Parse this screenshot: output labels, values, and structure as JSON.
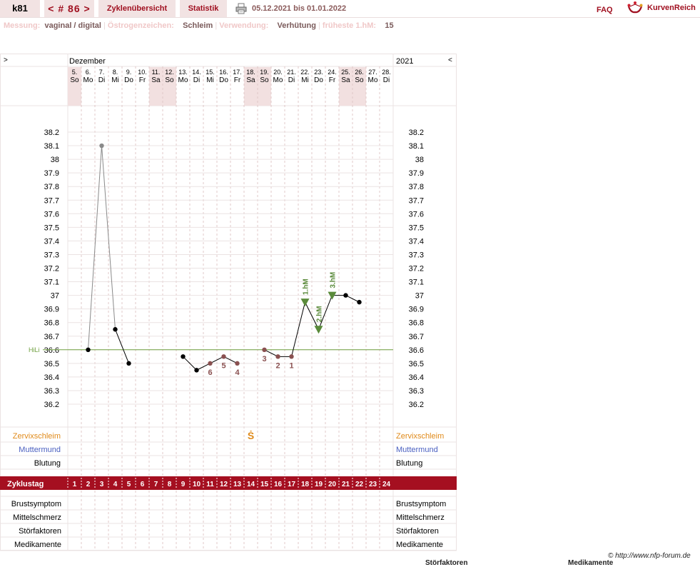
{
  "topbar": {
    "user": "k81",
    "cycle": "< # 86 >",
    "tab_overview": "Zyklenübersicht",
    "tab_stats": "Statistik",
    "date_range": "05.12.2021 bis 01.01.2022",
    "faq": "FAQ",
    "logo_text": "KurvenReich"
  },
  "info": {
    "measure_label": "Messung:",
    "measure_value": "vaginal / digital",
    "estrogen_label": "Östrogenzeichen:",
    "estrogen_value": "Schleim",
    "use_label": "Verwendung:",
    "use_value": "Verhütung",
    "earliest_label": "früheste 1.hM:",
    "earliest_value": "15"
  },
  "nav": {
    "prev": ">",
    "next": "<",
    "month": "Dezember",
    "year": "2021"
  },
  "chart_data": {
    "type": "line",
    "days": [
      {
        "date": "5.",
        "wd": "So",
        "weekend": true
      },
      {
        "date": "6.",
        "wd": "Mo",
        "weekend": false
      },
      {
        "date": "7.",
        "wd": "Di",
        "weekend": false
      },
      {
        "date": "8.",
        "wd": "Mi",
        "weekend": false
      },
      {
        "date": "9.",
        "wd": "Do",
        "weekend": false
      },
      {
        "date": "10.",
        "wd": "Fr",
        "weekend": false
      },
      {
        "date": "11.",
        "wd": "Sa",
        "weekend": true
      },
      {
        "date": "12.",
        "wd": "So",
        "weekend": true
      },
      {
        "date": "13.",
        "wd": "Mo",
        "weekend": false
      },
      {
        "date": "14.",
        "wd": "Di",
        "weekend": false
      },
      {
        "date": "15.",
        "wd": "Mi",
        "weekend": false
      },
      {
        "date": "16.",
        "wd": "Do",
        "weekend": false
      },
      {
        "date": "17.",
        "wd": "Fr",
        "weekend": false
      },
      {
        "date": "18.",
        "wd": "Sa",
        "weekend": true
      },
      {
        "date": "19.",
        "wd": "So",
        "weekend": true
      },
      {
        "date": "20.",
        "wd": "Mo",
        "weekend": false
      },
      {
        "date": "21.",
        "wd": "Di",
        "weekend": false
      },
      {
        "date": "22.",
        "wd": "Mi",
        "weekend": false
      },
      {
        "date": "23.",
        "wd": "Do",
        "weekend": false
      },
      {
        "date": "24.",
        "wd": "Fr",
        "weekend": false
      },
      {
        "date": "25.",
        "wd": "Sa",
        "weekend": true
      },
      {
        "date": "26.",
        "wd": "So",
        "weekend": true
      },
      {
        "date": "27.",
        "wd": "Mo",
        "weekend": false
      },
      {
        "date": "28.",
        "wd": "Di",
        "weekend": false
      }
    ],
    "cycle_days": [
      "1",
      "2",
      "3",
      "4",
      "5",
      "6",
      "7",
      "8",
      "9",
      "10",
      "11",
      "12",
      "13",
      "14",
      "15",
      "16",
      "17",
      "18",
      "19",
      "20",
      "21",
      "22",
      "23",
      "24"
    ],
    "y_ticks": [
      "38.2",
      "38.1",
      "38",
      "37.9",
      "37.8",
      "37.7",
      "37.6",
      "37.5",
      "37.4",
      "37.3",
      "37.2",
      "37.1",
      "37",
      "36.9",
      "36.8",
      "36.7",
      "36.6",
      "36.5",
      "36.4",
      "36.3",
      "36.2"
    ],
    "ylim": [
      36.2,
      38.2
    ],
    "temperatures": [
      null,
      36.6,
      38.1,
      36.75,
      36.5,
      null,
      null,
      null,
      36.55,
      36.45,
      36.5,
      36.55,
      36.5,
      null,
      36.6,
      36.55,
      36.55,
      36.95,
      36.75,
      37.0,
      37.0,
      36.95,
      null,
      null
    ],
    "excluded_days": [
      2
    ],
    "connect_to_excluded": [
      1,
      3
    ],
    "marked_days": [
      10,
      11,
      12,
      14,
      15,
      16
    ],
    "low_counts": [
      {
        "day": 10,
        "label": "6"
      },
      {
        "day": 11,
        "label": "5"
      },
      {
        "day": 12,
        "label": "4"
      },
      {
        "day": 14,
        "label": "3"
      },
      {
        "day": 15,
        "label": "2"
      },
      {
        "day": 16,
        "label": "1"
      }
    ],
    "high_marks": [
      {
        "day": 17,
        "label": "1.hM"
      },
      {
        "day": 18,
        "label": "2.hM"
      },
      {
        "day": 19,
        "label": "3.hM"
      }
    ],
    "hili_label": "HiLi",
    "hili_value": 36.6,
    "mucus_symbol": "Ṡ",
    "mucus_day": 13,
    "rows_left": {
      "mucus": "Zervixschleim",
      "cervix": "Muttermund",
      "bleeding": "Blutung",
      "cycle_day": "Zyklustag",
      "breast": "Brustsymptom",
      "midpain": "Mittelschmerz",
      "disturb": "Störfaktoren",
      "meds": "Medikamente"
    },
    "colors": {
      "accent": "#a50f20",
      "mucus": "#e08a1a",
      "cervix": "#4a5fc0",
      "grid_v": "#e0c8c8",
      "grid_h": "#ebe3e3",
      "weekend": "#f2e0e0",
      "hili": "#70a040",
      "high": "#5a8a3a",
      "low": "#8a5050"
    }
  },
  "footer": {
    "copyright": "© http://www.nfp-forum.de",
    "bottom_a": "Störfaktoren",
    "bottom_b": "Medikamente"
  }
}
